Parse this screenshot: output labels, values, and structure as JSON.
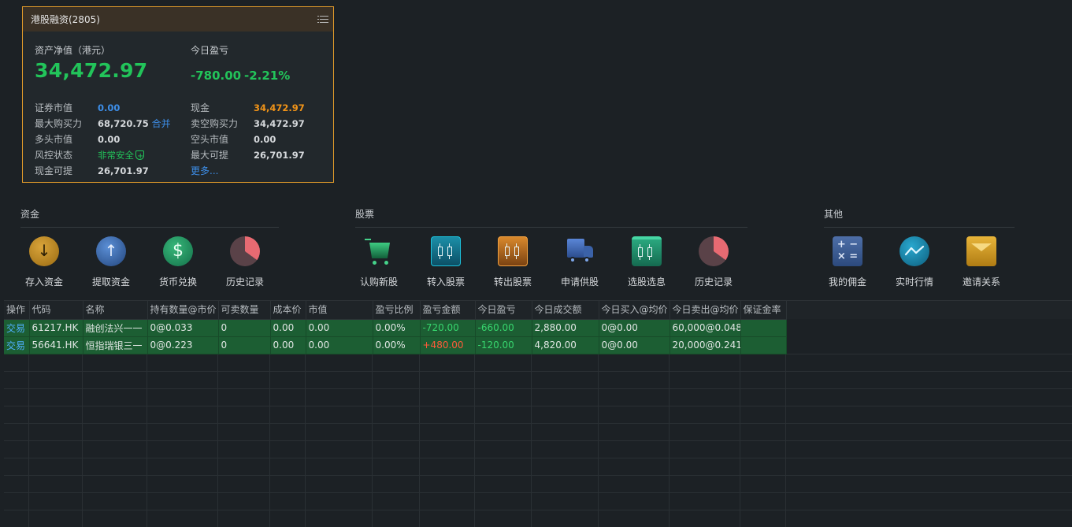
{
  "account": {
    "title": "港股融资(2805)",
    "nav_label": "资产净值（港元）",
    "nav_value": "34,472.97",
    "today_pl_label": "今日盈亏",
    "today_pl_value": "-780.00",
    "today_pl_pct": "-2.21%",
    "left_items": [
      {
        "k": "证券市值",
        "v": "0.00"
      },
      {
        "k": "最大购买力",
        "v": "68,720.75",
        "link": "合并"
      },
      {
        "k": "多头市值",
        "v": "0.00"
      },
      {
        "k": "风控状态",
        "v": "非常安全"
      },
      {
        "k": "现金可提",
        "v": "26,701.97"
      }
    ],
    "right_items": [
      {
        "k": "现金",
        "v": "34,472.97"
      },
      {
        "k": "卖空购买力",
        "v": "34,472.97"
      },
      {
        "k": "空头市值",
        "v": "0.00"
      },
      {
        "k": "最大可提",
        "v": "26,701.97"
      },
      {
        "more": "更多..."
      }
    ]
  },
  "sections": {
    "funds": {
      "title": "资金",
      "items": [
        {
          "label": "存入资金",
          "icon": "deposit-icon"
        },
        {
          "label": "提取资金",
          "icon": "withdraw-icon"
        },
        {
          "label": "货币兑换",
          "icon": "currency-exchange-icon"
        },
        {
          "label": "历史记录",
          "icon": "history-icon"
        }
      ]
    },
    "stocks": {
      "title": "股票",
      "items": [
        {
          "label": "认购新股",
          "icon": "cart-icon"
        },
        {
          "label": "转入股票",
          "icon": "transfer-in-icon"
        },
        {
          "label": "转出股票",
          "icon": "transfer-out-icon"
        },
        {
          "label": "申请供股",
          "icon": "truck-icon"
        },
        {
          "label": "选股选息",
          "icon": "stock-pick-icon"
        },
        {
          "label": "历史记录",
          "icon": "history-icon"
        }
      ]
    },
    "other": {
      "title": "其他",
      "items": [
        {
          "label": "我的佣金",
          "icon": "calculator-icon"
        },
        {
          "label": "实时行情",
          "icon": "realtime-chart-icon"
        },
        {
          "label": "邀请关系",
          "icon": "mail-icon"
        }
      ]
    }
  },
  "table": {
    "headers": [
      "操作",
      "代码",
      "名称",
      "持有数量@市价",
      "可卖数量",
      "成本价",
      "市值",
      "盈亏比例",
      "盈亏金额",
      "今日盈亏",
      "今日成交额",
      "今日买入@均价",
      "今日卖出@均价",
      "保证金率"
    ],
    "rows": [
      [
        "交易",
        "61217.HK",
        "融创法兴一一",
        "0@0.033",
        "0",
        "0.00",
        "0.00",
        "0.00%",
        "-720.00",
        "-660.00",
        "2,880.00",
        "0@0.00",
        "60,000@0.048",
        ""
      ],
      [
        "交易",
        "56641.HK",
        "恒指瑞银三一",
        "0@0.223",
        "0",
        "0.00",
        "0.00",
        "0.00%",
        "+480.00",
        "-120.00",
        "4,820.00",
        "0@0.00",
        "20,000@0.241",
        ""
      ]
    ]
  },
  "colors": {
    "accent_orange": "#e09a2a",
    "gain_green": "#22c45a",
    "loss_red": "#ff5b3a",
    "link_blue": "#3d8ee8",
    "row_green": "#1c5e33"
  }
}
